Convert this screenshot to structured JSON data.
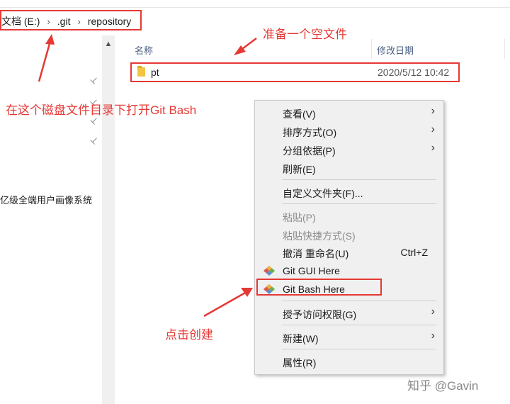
{
  "address_bar": {
    "crumbs": [
      "文档 (E:)",
      ".git",
      "repository"
    ],
    "separator": "›"
  },
  "nav_pane": {
    "scroll_up": "▲",
    "pin_icon": "📌",
    "item_text": "亿级全端用户画像系统"
  },
  "columns": {
    "name": "名称",
    "date": "修改日期"
  },
  "files": [
    {
      "name": "pt",
      "modified": "2020/5/12 10:42",
      "icon": "folder-icon"
    }
  ],
  "context_menu": {
    "items": [
      {
        "label": "查看(V)",
        "arrow": "›"
      },
      {
        "label": "排序方式(O)",
        "arrow": "›"
      },
      {
        "label": "分组依据(P)",
        "arrow": "›"
      },
      {
        "label": "刷新(E)"
      },
      {
        "label": "自定义文件夹(F)..."
      },
      {
        "label": "粘贴(P)",
        "disabled": true
      },
      {
        "label": "粘贴快捷方式(S)",
        "disabled": true
      },
      {
        "label": "撤消 重命名(U)",
        "shortcut": "Ctrl+Z"
      },
      {
        "label": "Git GUI Here",
        "icon": "git-icon"
      },
      {
        "label": "Git Bash Here",
        "icon": "git-icon"
      },
      {
        "label": "授予访问权限(G)",
        "arrow": "›"
      },
      {
        "label": "新建(W)",
        "arrow": "›"
      },
      {
        "label": "属性(R)"
      }
    ]
  },
  "annotations": {
    "empty_file": "准备一个空文件",
    "open_bash": "在这个磁盘文件目录下打开Git Bash",
    "click_create": "点击创建"
  },
  "watermark": "知乎 @Gavin",
  "colors": {
    "annotation_red": "#e53935",
    "menu_bg": "#f0f0f0",
    "folder": "#f3c342"
  }
}
